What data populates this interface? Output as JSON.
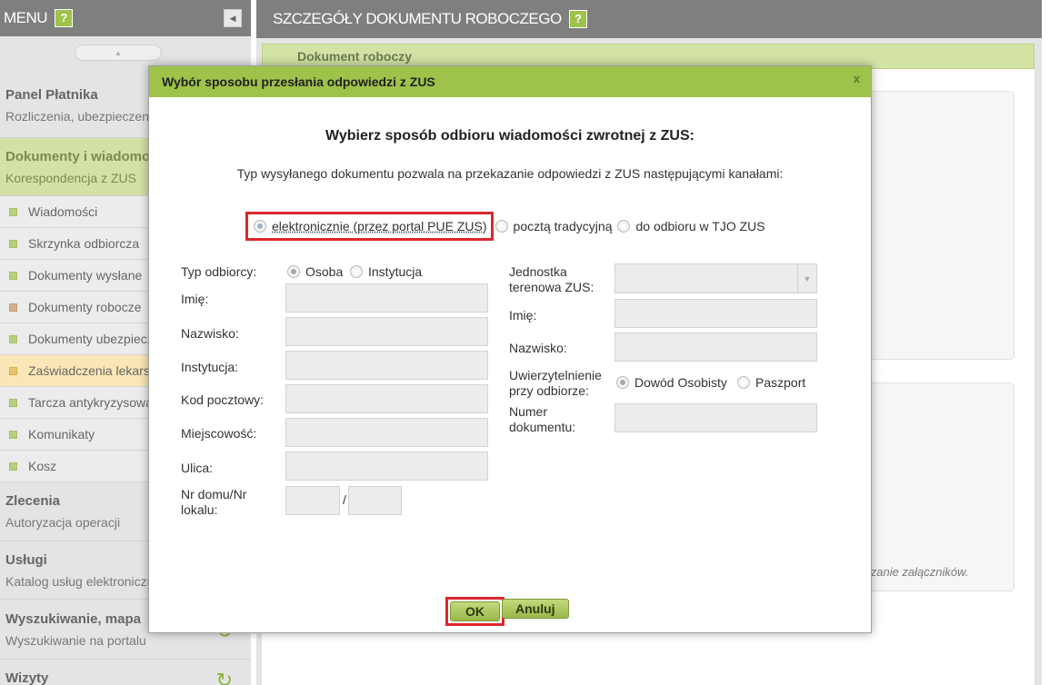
{
  "sidebar": {
    "header": "MENU",
    "help": "?",
    "sections": [
      {
        "title": "Panel Płatnika",
        "subtitle": "Rozliczenia, ubezpieczeni"
      },
      {
        "title": "Dokumenty i wiadomości",
        "subtitle": "Korespondencja z ZUS"
      },
      {
        "title": "Zlecenia",
        "subtitle": "Autoryzacja operacji"
      },
      {
        "title": "Usługi",
        "subtitle": "Katalog usług elektronicznych"
      },
      {
        "title": "Wyszukiwanie, mapa",
        "subtitle": "Wyszukiwanie na portalu"
      },
      {
        "title": "Wizyty",
        "subtitle": ""
      }
    ],
    "items": [
      {
        "label": "Wiadomości"
      },
      {
        "label": "Skrzynka odbiorcza"
      },
      {
        "label": "Dokumenty wysłane"
      },
      {
        "label": "Dokumenty robocze"
      },
      {
        "label": "Dokumenty ubezpieczonych"
      },
      {
        "label": "Zaświadczenia lekarskie"
      },
      {
        "label": "Tarcza antykryzysowa"
      },
      {
        "label": "Komunikaty"
      },
      {
        "label": "Kosz"
      }
    ]
  },
  "main": {
    "header": "SZCZEGÓŁY DOKUMENTU ROBOCZEGO",
    "help": "?",
    "subheader": "Dokument roboczy",
    "bg_note": "ączanie załączników."
  },
  "modal": {
    "title": "Wybór sposobu przesłania odpowiedzi z ZUS",
    "close": "x",
    "heading": "Wybierz sposób odbioru wiadomości zwrotnej z ZUS:",
    "description": "Typ wysyłanego dokumentu pozwala na przekazanie odpowiedzi z ZUS następującymi kanałami:",
    "channels": {
      "electronic": "elektronicznie (przez portal PUE ZUS)",
      "post": "pocztą tradycyjną",
      "tjo": "do odbioru w TJO ZUS"
    },
    "left_form": {
      "recipient_type_label": "Typ odbiorcy:",
      "recipient_type_person": "Osoba",
      "recipient_type_institution": "Instytucja",
      "first_name_label": "Imię:",
      "last_name_label": "Nazwisko:",
      "institution_label": "Instytucja:",
      "postal_code_label": "Kod pocztowy:",
      "city_label": "Miejscowość:",
      "street_label": "Ulica:",
      "house_label_1": "Nr domu/Nr",
      "house_label_2": "lokalu:",
      "separator": "/"
    },
    "right_form": {
      "unit_label_1": "Jednostka",
      "unit_label_2": "terenowa ZUS:",
      "first_name_label": "Imię:",
      "last_name_label": "Nazwisko:",
      "auth_label_1": "Uwierzytelnienie",
      "auth_label_2": "przy odbiorze:",
      "auth_id_card": "Dowód Osobisty",
      "auth_passport": "Paszport",
      "doc_number_label_1": "Numer",
      "doc_number_label_2": "dokumentu:"
    },
    "buttons": {
      "ok": "OK",
      "cancel": "Anuluj"
    }
  }
}
